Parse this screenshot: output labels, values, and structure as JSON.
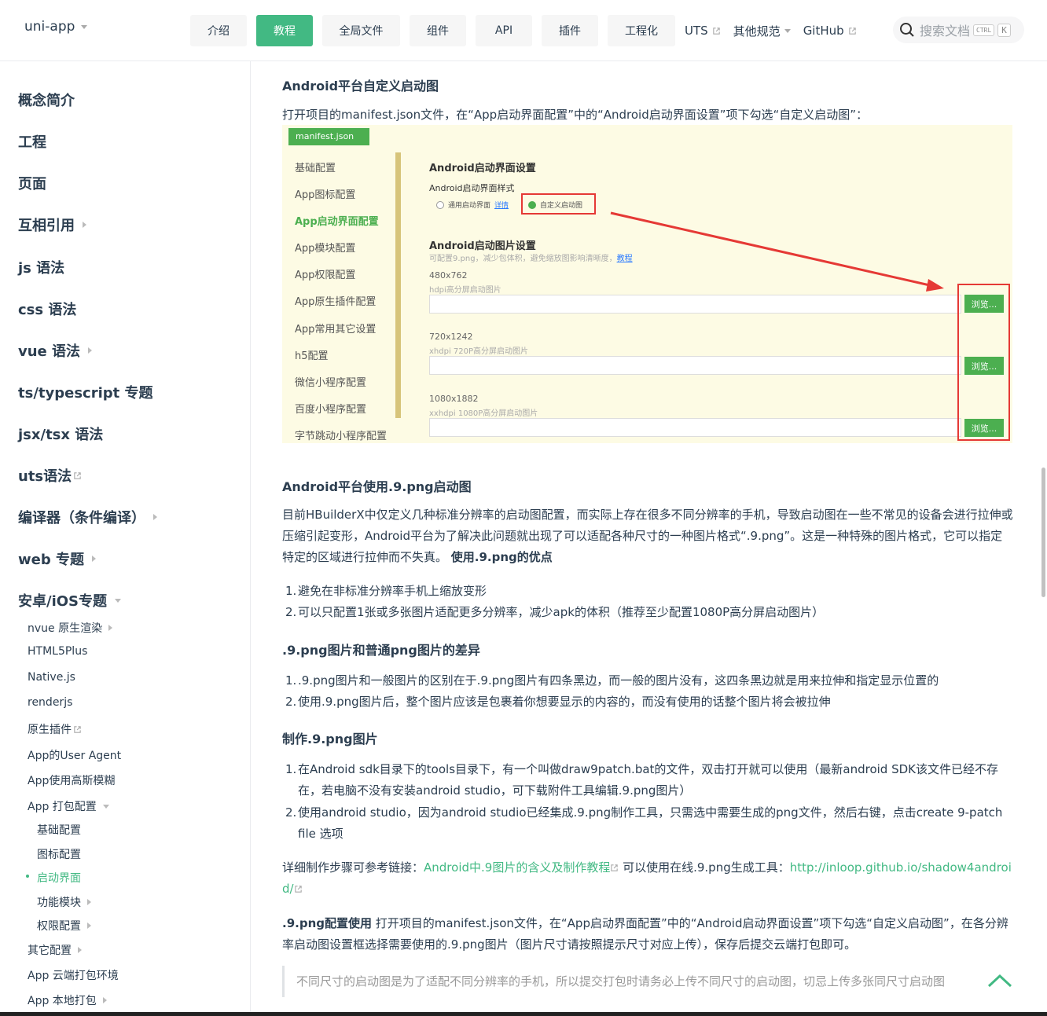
{
  "header": {
    "brand": "uni-app",
    "nav": [
      {
        "label": "介绍",
        "active": false
      },
      {
        "label": "教程",
        "active": true
      },
      {
        "label": "全局文件",
        "active": false
      },
      {
        "label": "组件",
        "active": false
      },
      {
        "label": "API",
        "active": false
      },
      {
        "label": "插件",
        "active": false
      },
      {
        "label": "工程化",
        "active": false
      }
    ],
    "links": {
      "uts": "UTS",
      "other": "其他规范",
      "github": "GitHub"
    },
    "search": {
      "placeholder": "搜索文档",
      "kbd_ctrl": "CTRL",
      "kbd_k": "K"
    }
  },
  "sidebar": {
    "top_items": [
      "概念简介",
      "工程",
      "页面",
      "互相引用",
      "js 语法",
      "css 语法",
      "vue 语法",
      "ts/typescript 专题",
      "jsx/tsx 语法",
      "uts语法",
      "编译器（条件编译）",
      "web 专题",
      "安卓/iOS专题"
    ],
    "sub_items": [
      "nvue 原生渲染",
      "HTML5Plus",
      "Native.js",
      "renderjs",
      "原生插件",
      "App的User Agent",
      "App使用高斯模糊",
      "App 打包配置"
    ],
    "sub2_items": [
      "基础配置",
      "图标配置",
      "启动界面",
      "功能模块",
      "权限配置"
    ],
    "sub_items_after": [
      "其它配置",
      "App 云端打包环境",
      "App 本地打包"
    ]
  },
  "content": {
    "h_custom": "Android平台自定义启动图",
    "p_custom": "打开项目的manifest.json文件，在“App启动界面配置”中的“Android启动界面设置”项下勾选“自定义启动图”：",
    "figure": {
      "tab": "manifest.json",
      "menu": [
        "基础配置",
        "App图标配置",
        "App启动界面配置",
        "App模块配置",
        "App权限配置",
        "App原生插件配置",
        "App常用其它设置",
        "h5配置",
        "微信小程序配置",
        "百度小程序配置",
        "字节跳动小程序配置"
      ],
      "section_title": "Android启动界面设置",
      "style_label": "Android启动界面样式",
      "radio_common": "通用启动界面",
      "radio_link": "详情",
      "radio_custom": "自定义启动图",
      "image_title": "Android启动图片设置",
      "image_hint": "可配置9.png，减少包体积，避免缩放图影响清晰度，",
      "image_hint_link": "教程",
      "sizes": [
        {
          "size": "480x762",
          "desc": "hdpi高分屏启动图片"
        },
        {
          "size": "720x1242",
          "desc": "xhdpi 720P高分屏启动图片"
        },
        {
          "size": "1080x1882",
          "desc": "xxhdpi 1080P高分屏启动图片"
        }
      ],
      "browse": "浏览..."
    },
    "h_9png": "Android平台使用.9.png启动图",
    "p_9png_1": "目前HBuilderX中仅定义几种标准分辨率的启动图配置，而实际上存在很多不同分辨率的手机，导致启动图在一些不常见的设备会进行拉伸或压缩引起变形，Android平台为了解决此问题就出现了可以适配各种尺寸的一种图片格式“.9.png”。这是一种特殊的图片格式，它可以指定特定的区域进行拉伸而不失真。",
    "p_9png_bold": "使用.9.png的优点",
    "adv": [
      "避免在非标准分辨率手机上缩放变形",
      "可以只配置1张或多张图片适配更多分辨率，减少apk的体积（推荐至少配置1080P高分屏启动图片）"
    ],
    "h_diff": ".9.png图片和普通png图片的差异",
    "diff": [
      ".9.png图片和一般图片的区别在于.9.png图片有四条黑边，而一般的图片没有，这四条黑边就是用来拉伸和指定显示位置的",
      "使用.9.png图片后，整个图片应该是包裹着你想要显示的内容的，而没有使用的话整个图片将会被拉伸"
    ],
    "h_make": "制作.9.png图片",
    "make": [
      "在Android sdk目录下的tools目录下，有一个叫做draw9patch.bat的文件，双击打开就可以使用（最新android SDK该文件已经不存在，若电脑不没有安装android studio，可下载附件工具编辑.9.png图片）",
      "使用android studio，因为android studio已经集成.9.png制作工具，只需选中需要生成的png文件，然后右键，点击create 9-patch file 选项"
    ],
    "detail_prefix": "详细制作步骤可参考链接：",
    "detail_link1": "Android中.9图片的含义及制作教程",
    "detail_mid": " 可以使用在线.9.png生成工具：",
    "detail_link2": "http://inloop.github.io/shadow4android/",
    "cfg_bold": ".9.png配置使用",
    "cfg_text": " 打开项目的manifest.json文件，在“App启动界面配置”中的“Android启动界面设置”项下勾选“自定义启动图”，在各分辨率启动图设置框选择需要使用的.9.png图片（图片尺寸请按照提示尺寸对应上传），保存后提交云端打包即可。",
    "quote": "不同尺寸的启动图是为了适配不同分辨率的手机，所以提交打包时请务必上传不同尺寸的启动图，切忌上传多张同尺寸启动图"
  },
  "colors": {
    "accent": "#42b983",
    "figure_bg": "#fdfbe4",
    "red": "#e53935"
  }
}
